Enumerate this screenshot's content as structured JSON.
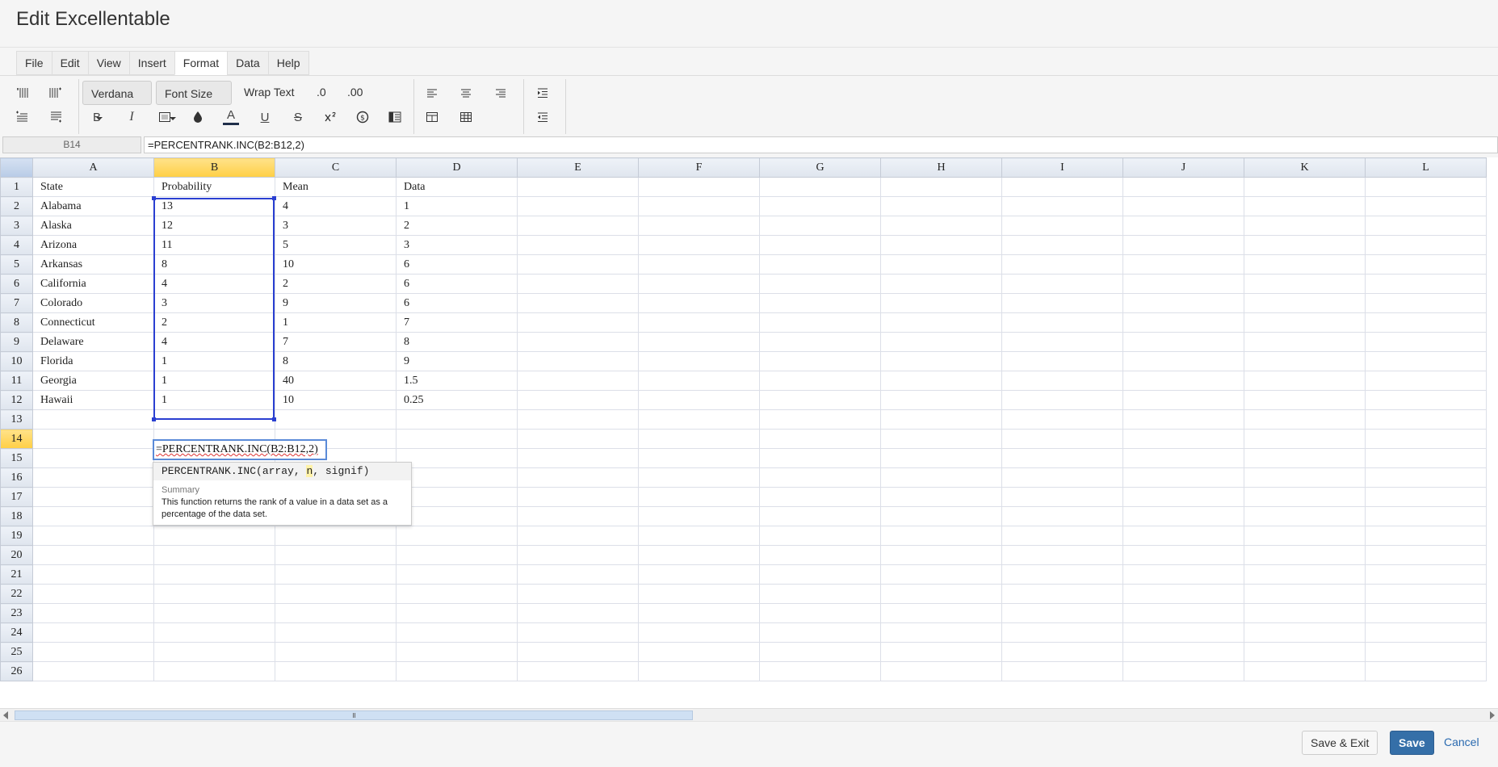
{
  "app": {
    "title": "Edit Excellentable"
  },
  "menu": {
    "items": [
      "File",
      "Edit",
      "View",
      "Insert",
      "Format",
      "Data",
      "Help"
    ],
    "active": "Format"
  },
  "toolbar": {
    "font_family": "Verdana",
    "font_size": "Font Size",
    "wrap_text": "Wrap Text",
    "decrease_decimal": ".0",
    "increase_decimal": ".00",
    "bold": "B",
    "italic": "I",
    "font_color": "A",
    "underline": "U",
    "strikethrough": "S"
  },
  "formula_bar": {
    "cell_ref": "B14",
    "formula": "=PERCENTRANK.INC(B2:B12,2)"
  },
  "sheet": {
    "columns": [
      "A",
      "B",
      "C",
      "D",
      "E",
      "F",
      "G",
      "H",
      "I",
      "J",
      "K",
      "L"
    ],
    "selected_column": "B",
    "selected_row": "14",
    "rows": [
      {
        "num": "1",
        "cells": [
          "State",
          "Probability",
          "Mean",
          "Data"
        ]
      },
      {
        "num": "2",
        "cells": [
          "Alabama",
          "13",
          "4",
          "1"
        ]
      },
      {
        "num": "3",
        "cells": [
          "Alaska",
          "12",
          "3",
          "2"
        ]
      },
      {
        "num": "4",
        "cells": [
          "Arizona",
          "11",
          "5",
          "3"
        ]
      },
      {
        "num": "5",
        "cells": [
          "Arkansas",
          "8",
          "10",
          "6"
        ]
      },
      {
        "num": "6",
        "cells": [
          "California",
          "4",
          "2",
          "6"
        ]
      },
      {
        "num": "7",
        "cells": [
          "Colorado",
          "3",
          "9",
          "6"
        ]
      },
      {
        "num": "8",
        "cells": [
          "Connecticut",
          "2",
          "1",
          "7"
        ]
      },
      {
        "num": "9",
        "cells": [
          "Delaware",
          "4",
          "7",
          "8"
        ]
      },
      {
        "num": "10",
        "cells": [
          "Florida",
          "1",
          "8",
          "9"
        ]
      },
      {
        "num": "11",
        "cells": [
          "Georgia",
          "1",
          "40",
          "1.5"
        ]
      },
      {
        "num": "12",
        "cells": [
          "Hawaii",
          "1",
          "10",
          "0.25"
        ]
      },
      {
        "num": "13",
        "cells": []
      },
      {
        "num": "14",
        "cells": []
      },
      {
        "num": "15",
        "cells": []
      },
      {
        "num": "16",
        "cells": []
      },
      {
        "num": "17",
        "cells": []
      },
      {
        "num": "18",
        "cells": []
      },
      {
        "num": "19",
        "cells": []
      },
      {
        "num": "20",
        "cells": []
      },
      {
        "num": "21",
        "cells": []
      },
      {
        "num": "22",
        "cells": []
      },
      {
        "num": "23",
        "cells": []
      },
      {
        "num": "24",
        "cells": []
      },
      {
        "num": "25",
        "cells": []
      },
      {
        "num": "26",
        "cells": []
      }
    ]
  },
  "editor": {
    "value": "=PERCENTRANK.INC(B2:B12,2)"
  },
  "tooltip": {
    "sig_prefix": "PERCENTRANK.INC(array, ",
    "sig_highlight": "n",
    "sig_suffix": ", signif)",
    "heading": "Summary",
    "body": "This function returns the rank of a value in a data set as a percentage of the data set."
  },
  "footer": {
    "save_exit": "Save & Exit",
    "save": "Save",
    "cancel": "Cancel"
  },
  "colors": {
    "accent": "#356fa8",
    "selection": "#2a3fd1",
    "header_selected": "#ffd24f"
  }
}
